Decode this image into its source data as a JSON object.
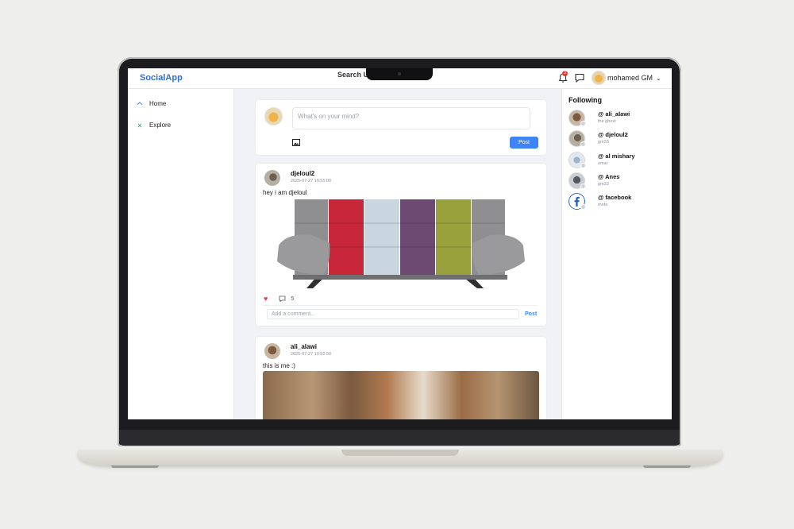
{
  "app": {
    "brand": "SocialApp",
    "search_label": "Search U"
  },
  "header": {
    "notification_count": "3",
    "user_name": "mohamed GM",
    "chevron": "⌄"
  },
  "sidebar": {
    "items": [
      {
        "icon": "home-icon",
        "label": "Home"
      },
      {
        "icon": "explore-icon",
        "label": "Explore"
      }
    ]
  },
  "composer": {
    "placeholder": "What's on your mind?",
    "post_label": "Post"
  },
  "posts": [
    {
      "author": "djeloul2",
      "timestamp": "2025-07-27 10:55:00",
      "text": "hey i am djeloul",
      "liked": true,
      "comment_count": "5",
      "comment_placeholder": "Add a comment...",
      "comment_post_label": "Post"
    },
    {
      "author": "ali_alawi",
      "timestamp": "2025-07-27 10:52:50",
      "text": "this is me :)"
    }
  ],
  "following": {
    "title": "Following",
    "items": [
      {
        "handle": "@ ali_alawi",
        "sub": "the ghost"
      },
      {
        "handle": "@ djeloul2",
        "sub": "gm33"
      },
      {
        "handle": "@ al mishary",
        "sub": "omar"
      },
      {
        "handle": "@ Anes",
        "sub": "gm33"
      },
      {
        "handle": "@ facebook",
        "sub": "meta"
      }
    ]
  },
  "colors": {
    "accent": "#3e84f6",
    "brand": "#2f6fd6",
    "like": "#e53950",
    "badge": "#e53935"
  }
}
